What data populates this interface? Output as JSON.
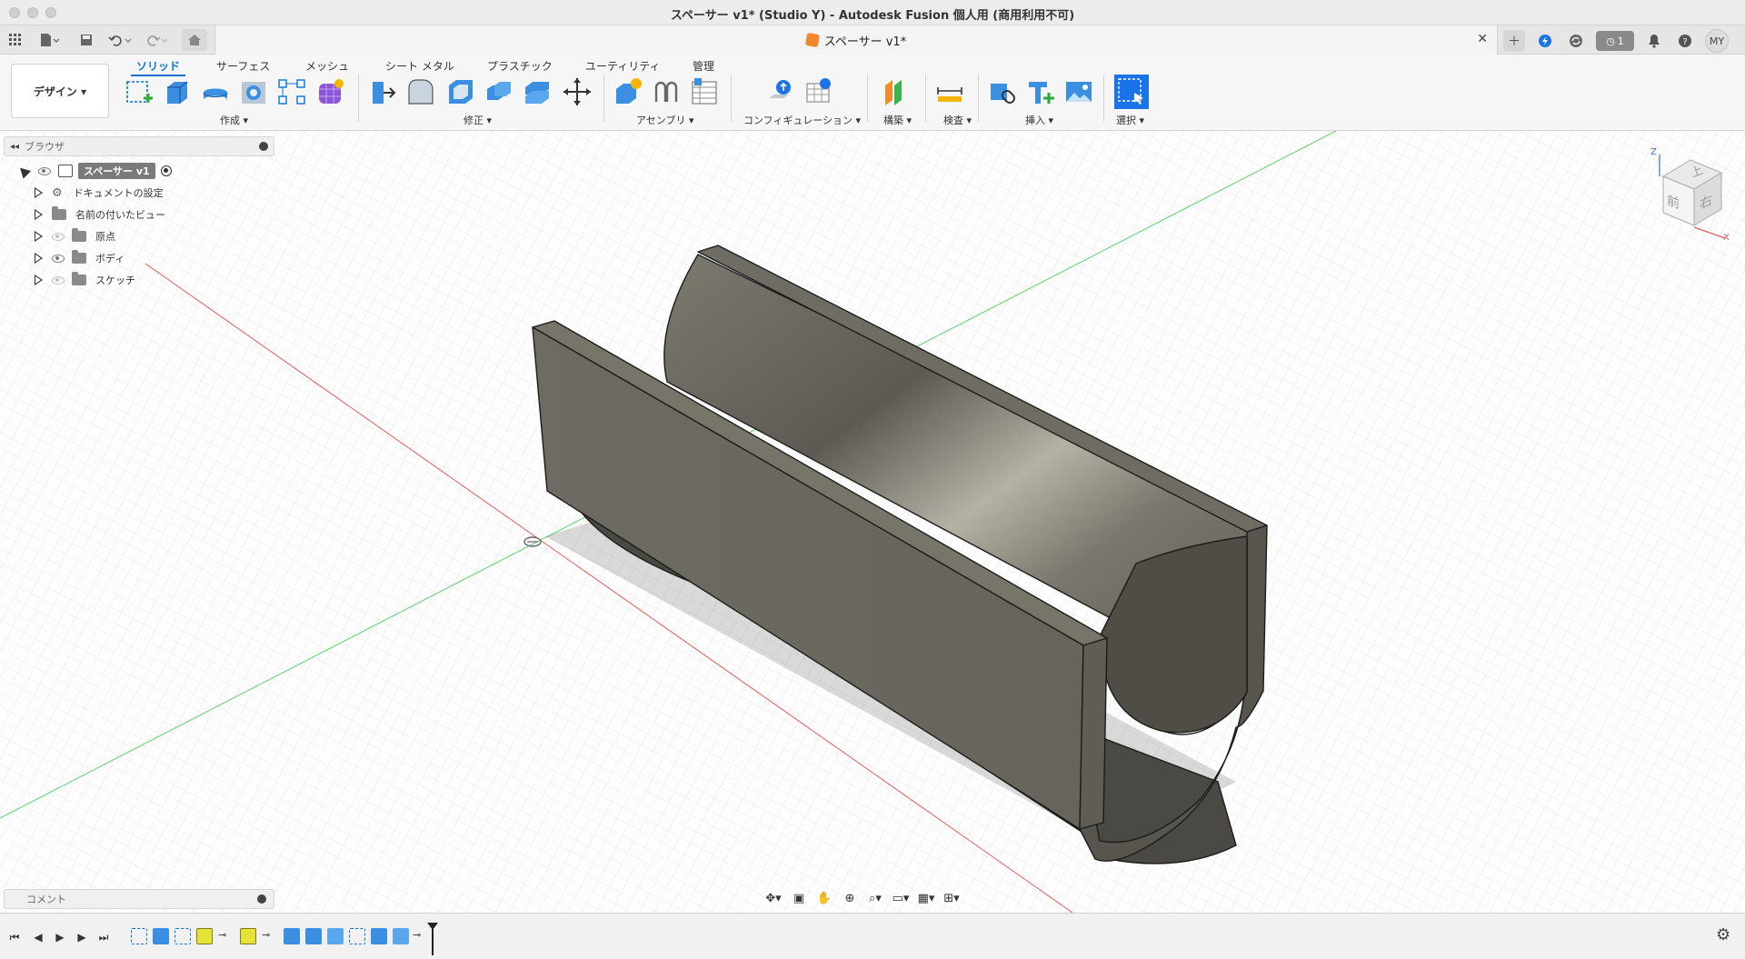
{
  "window": {
    "title": "スペーサー v1* (Studio Y) - Autodesk Fusion 個人用 (商用利用不可)"
  },
  "app_header": {
    "document_tab": "スペーサー v1*",
    "job_count": "1",
    "user_initials": "MY",
    "icons": [
      "apps-grid-icon",
      "file-icon",
      "save-icon",
      "undo-icon",
      "redo-icon",
      "home-icon",
      "close-icon",
      "add-tab-icon",
      "online-icon",
      "sync-icon",
      "job-status-icon",
      "notification-bell-icon",
      "help-icon"
    ]
  },
  "ribbon": {
    "workspace_label": "デザイン ▾",
    "tabs": [
      "ソリッド",
      "サーフェス",
      "メッシュ",
      "シート メタル",
      "プラスチック",
      "ユーティリティ",
      "管理"
    ],
    "active_tab": "ソリッド",
    "groups": [
      "作成 ▾",
      "修正 ▾",
      "アセンブリ ▾",
      "コンフィギュレーション ▾",
      "構築 ▾",
      "検査 ▾",
      "挿入 ▾",
      "選択 ▾"
    ]
  },
  "browser": {
    "header": "ブラウザ",
    "root": "スペーサー v1",
    "items": [
      "ドキュメントの設定",
      "名前の付いたビュー",
      "原点",
      "ボディ",
      "スケッチ"
    ]
  },
  "comments": {
    "label": "コメント"
  },
  "viewcube": {
    "top": "上",
    "front": "前",
    "right": "右",
    "axis_z": "Z",
    "axis_x": "X"
  },
  "colors": {
    "accent": "#0a74d6",
    "selected_highlight": "#e6e236",
    "body_face": "#6a685e",
    "axis_red": "#e25a5a",
    "axis_green": "#5fcf6a"
  }
}
